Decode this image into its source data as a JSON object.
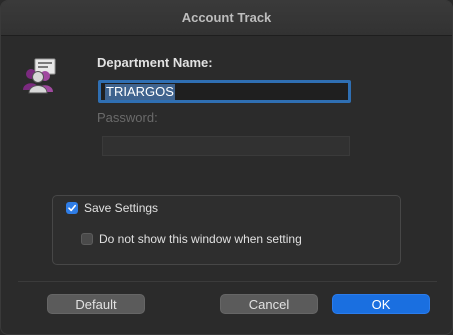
{
  "window": {
    "title": "Account Track"
  },
  "form": {
    "department_label": "Department Name:",
    "department_value": "TRIARGOS",
    "password_label": "Password:",
    "password_value": ""
  },
  "options": {
    "save_settings_label": "Save Settings",
    "save_settings_checked": true,
    "dont_show_label": "Do not show this window when setting",
    "dont_show_checked": false
  },
  "buttons": {
    "default_label": "Default",
    "cancel_label": "Cancel",
    "ok_label": "OK"
  },
  "colors": {
    "accent": "#1a6fe0",
    "selection": "#3f638e",
    "window_bg": "#2b2b2b"
  },
  "icons": {
    "app": "account-users-icon",
    "check": "checkmark-icon"
  }
}
